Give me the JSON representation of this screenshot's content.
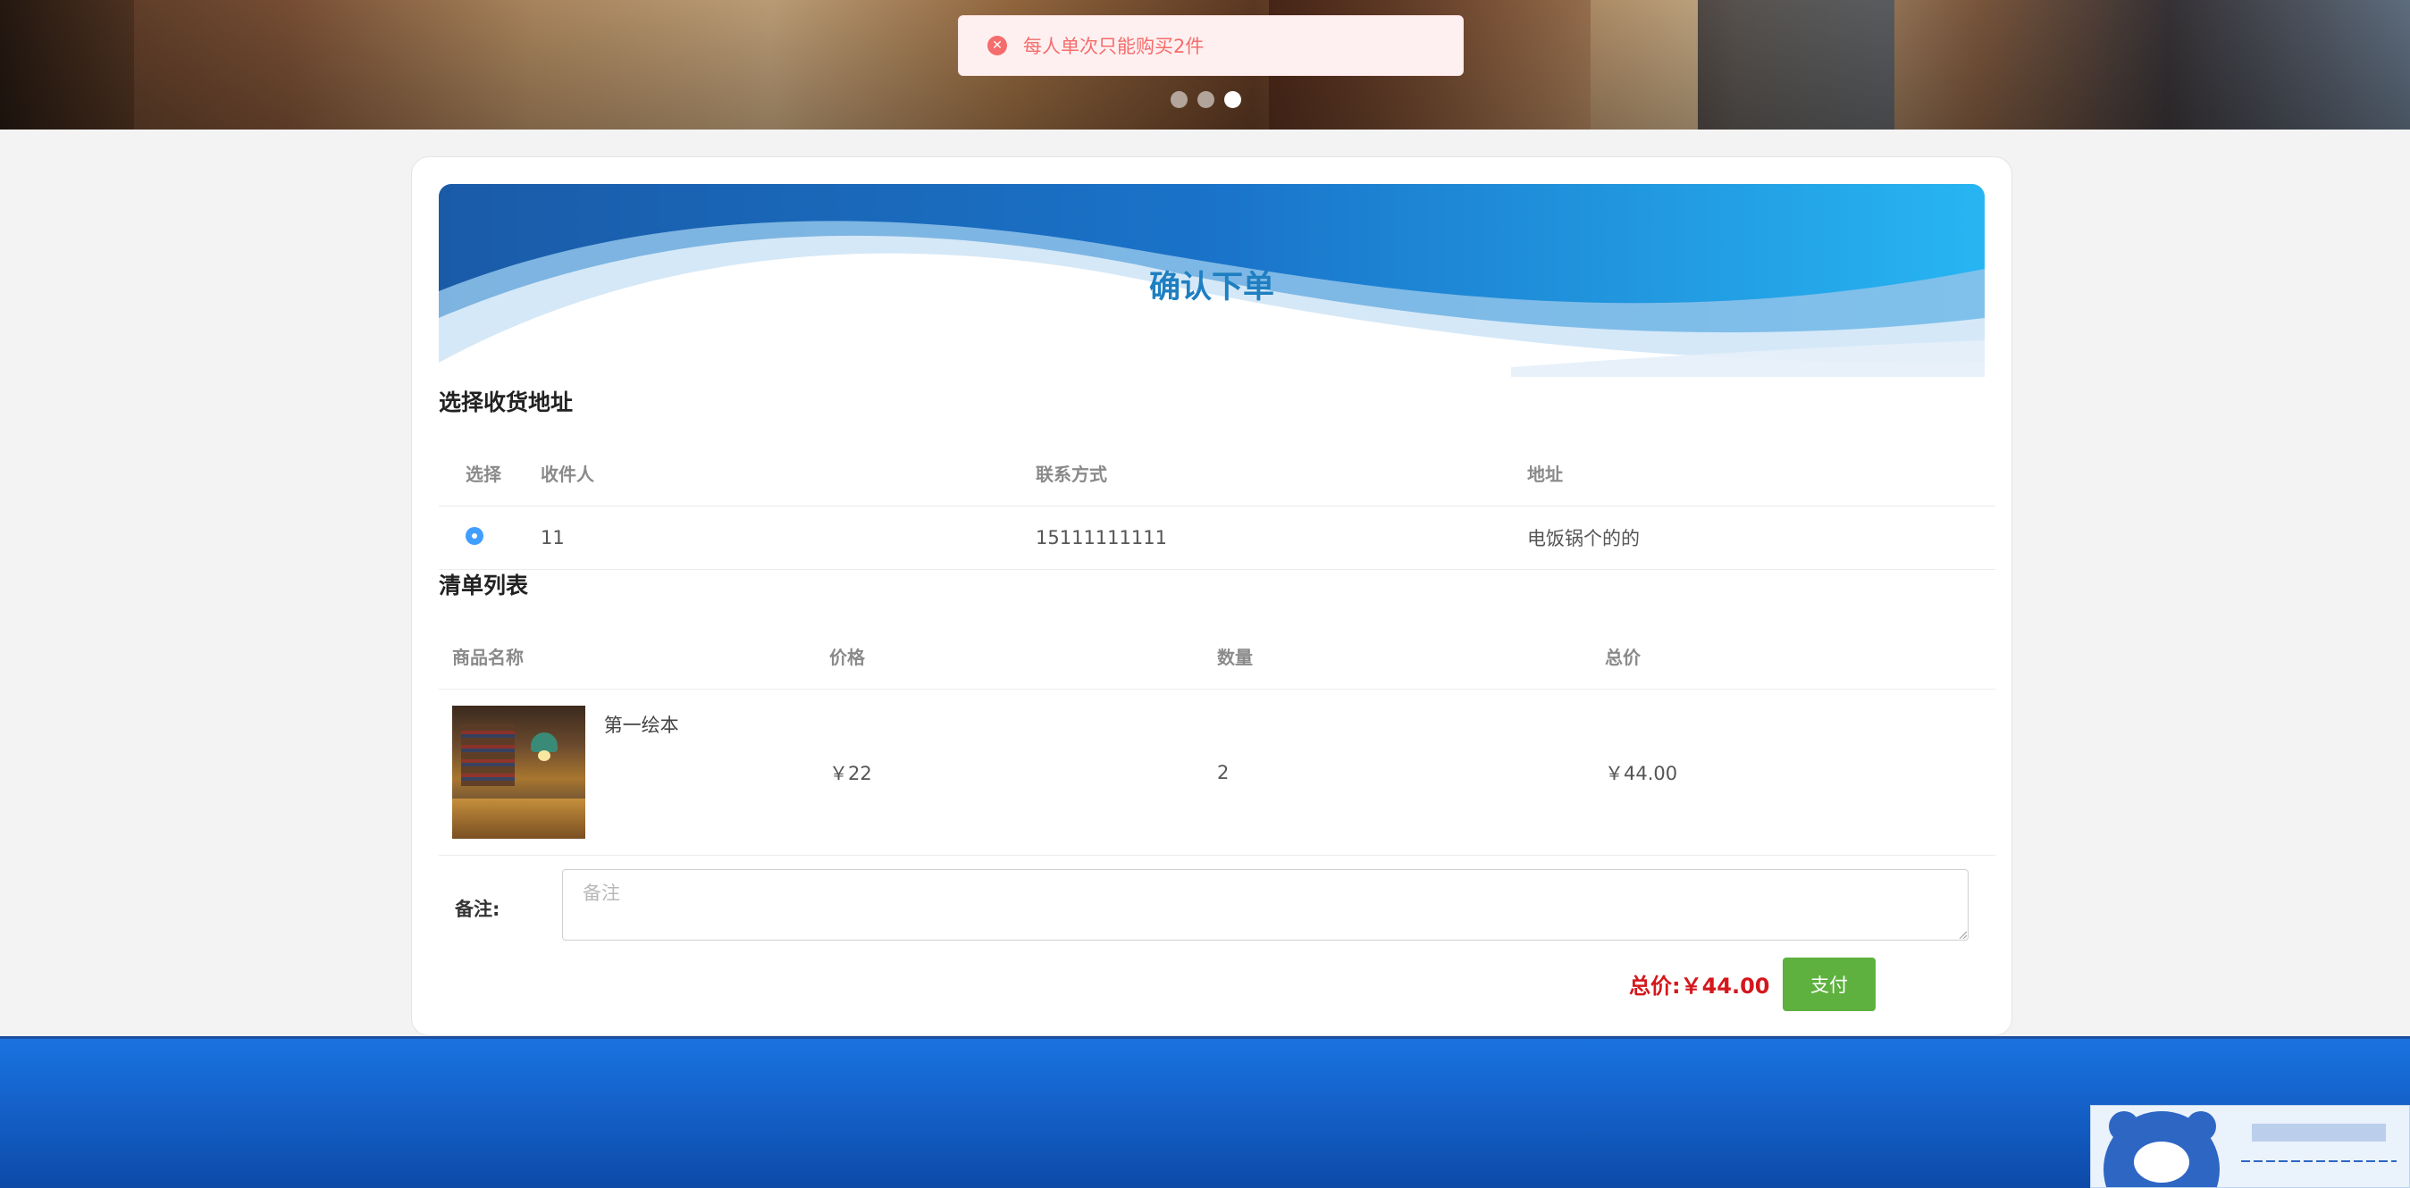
{
  "banner": {
    "slides_total": 3,
    "active_slide": 3
  },
  "toast": {
    "icon": "error-circle-icon",
    "message": "每人单次只能购买2件"
  },
  "hero": {
    "title": "确认下单"
  },
  "address_section": {
    "title": "选择收货地址",
    "columns": [
      "选择",
      "收件人",
      "联系方式",
      "地址"
    ],
    "rows": [
      {
        "selected": true,
        "recipient": "11",
        "phone": "15111111111",
        "address": "电饭锅个的的"
      }
    ]
  },
  "order_section": {
    "title": "清单列表",
    "columns": [
      "商品名称",
      "价格",
      "数量",
      "总价"
    ],
    "items": [
      {
        "name": "第一绘本",
        "price": "￥22",
        "quantity": "2",
        "subtotal": "￥44.00"
      }
    ]
  },
  "remark": {
    "label": "备注:",
    "placeholder": "备注",
    "value": ""
  },
  "summary": {
    "total_label": "总价:￥44.00",
    "pay_label": "支付"
  },
  "colors": {
    "accent": "#1e7fc1",
    "pay_button": "#5eb13f",
    "total_price": "#d4171c",
    "error": "#f56c6c",
    "footer": "#135fc6"
  }
}
